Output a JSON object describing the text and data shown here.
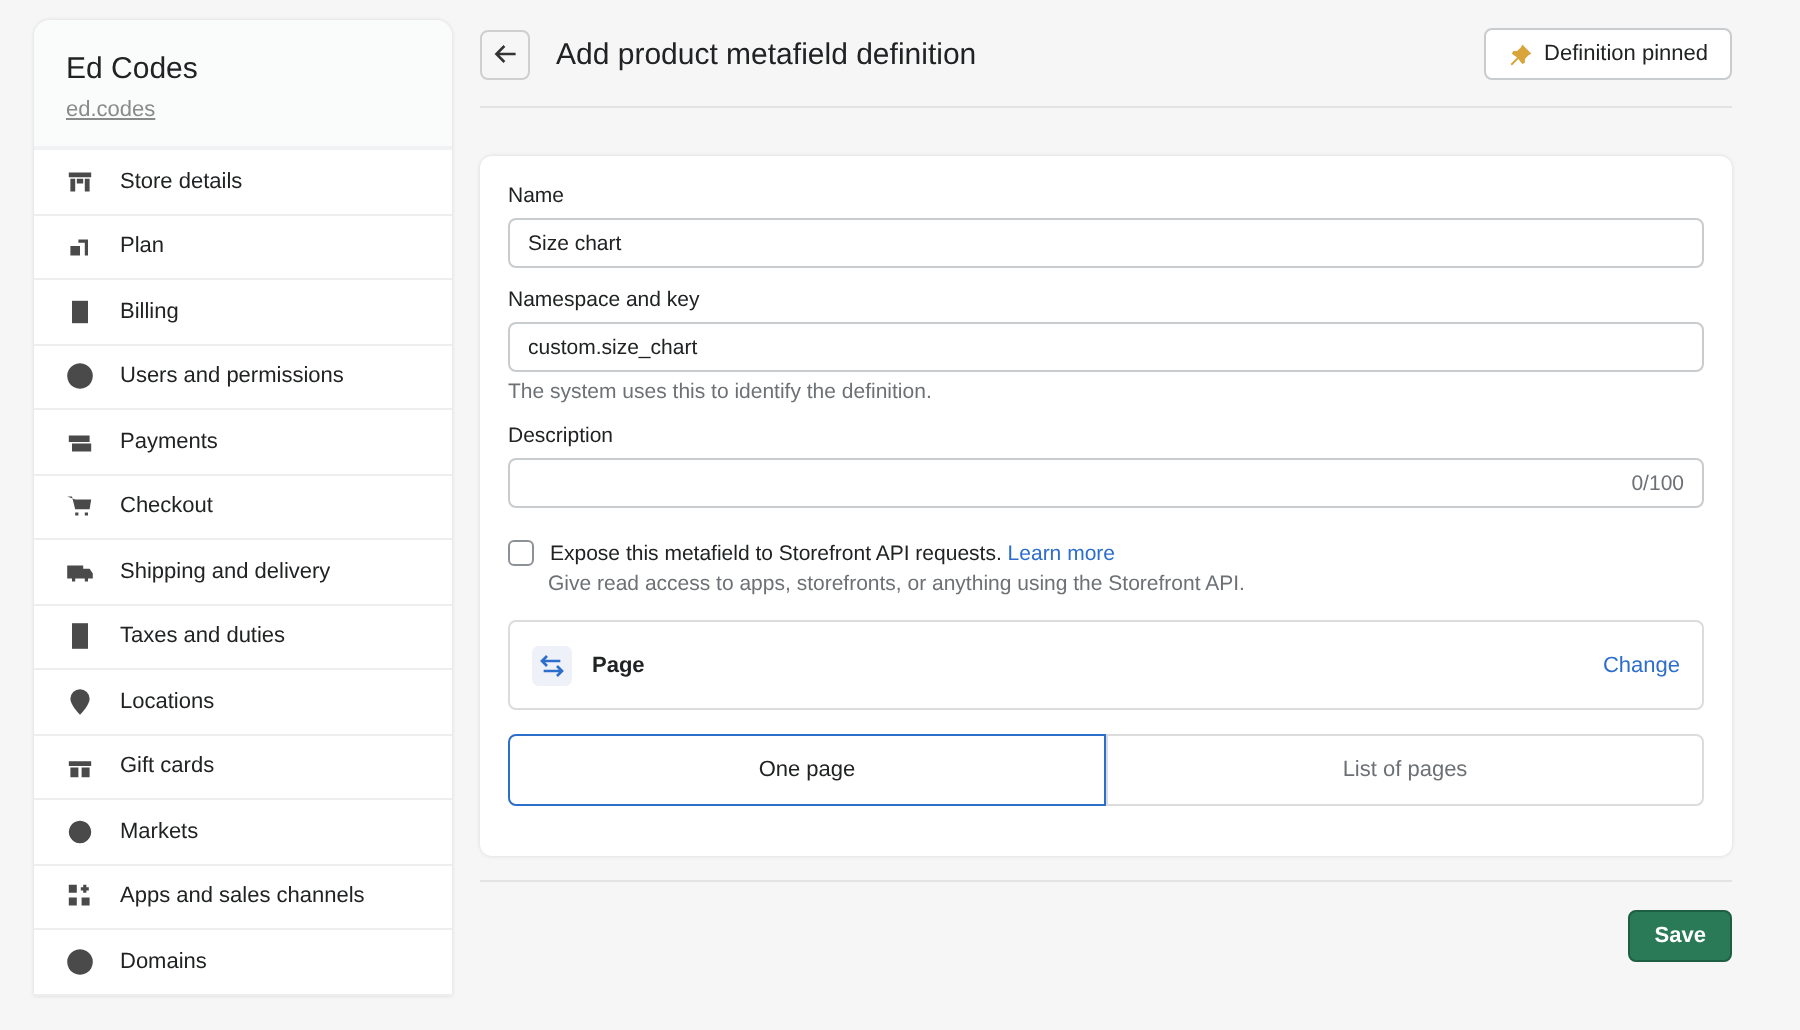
{
  "store": {
    "name": "Ed Codes",
    "domain": "ed.codes"
  },
  "sidebar": {
    "items": [
      {
        "label": "Store details",
        "selected": false
      },
      {
        "label": "Plan",
        "selected": false
      },
      {
        "label": "Billing",
        "selected": false
      },
      {
        "label": "Users and permissions",
        "selected": false
      },
      {
        "label": "Payments",
        "selected": false
      },
      {
        "label": "Checkout",
        "selected": false
      },
      {
        "label": "Shipping and delivery",
        "selected": false
      },
      {
        "label": "Taxes and duties",
        "selected": false
      },
      {
        "label": "Locations",
        "selected": false
      },
      {
        "label": "Gift cards",
        "selected": false
      },
      {
        "label": "Markets",
        "selected": false
      },
      {
        "label": "Apps and sales channels",
        "selected": false
      },
      {
        "label": "Domains",
        "selected": false
      }
    ]
  },
  "header": {
    "title": "Add product metafield definition",
    "pin_button": "Definition pinned"
  },
  "form": {
    "name": {
      "label": "Name",
      "value": "Size chart"
    },
    "namespace": {
      "label": "Namespace and key",
      "value": "custom.size_chart",
      "help": "The system uses this to identify the definition."
    },
    "description": {
      "label": "Description",
      "counter": "0/100"
    },
    "storefront": {
      "label": "Expose this metafield to Storefront API requests.",
      "link": "Learn more",
      "help": "Give read access to apps, storefronts, or anything using the Storefront API.",
      "checked": false
    },
    "type": {
      "label": "Page",
      "action": "Change"
    },
    "options": [
      {
        "label": "One page",
        "selected": true
      },
      {
        "label": "List of pages",
        "selected": false
      }
    ]
  },
  "save_button": "Save"
}
